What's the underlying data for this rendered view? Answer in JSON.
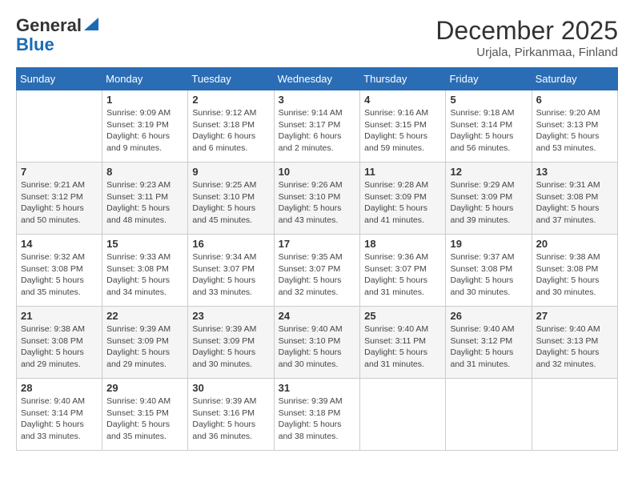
{
  "logo": {
    "general": "General",
    "blue": "Blue"
  },
  "title": {
    "month_year": "December 2025",
    "location": "Urjala, Pirkanmaa, Finland"
  },
  "weekdays": [
    "Sunday",
    "Monday",
    "Tuesday",
    "Wednesday",
    "Thursday",
    "Friday",
    "Saturday"
  ],
  "weeks": [
    [
      {
        "day": "",
        "info": ""
      },
      {
        "day": "1",
        "info": "Sunrise: 9:09 AM\nSunset: 3:19 PM\nDaylight: 6 hours\nand 9 minutes."
      },
      {
        "day": "2",
        "info": "Sunrise: 9:12 AM\nSunset: 3:18 PM\nDaylight: 6 hours\nand 6 minutes."
      },
      {
        "day": "3",
        "info": "Sunrise: 9:14 AM\nSunset: 3:17 PM\nDaylight: 6 hours\nand 2 minutes."
      },
      {
        "day": "4",
        "info": "Sunrise: 9:16 AM\nSunset: 3:15 PM\nDaylight: 5 hours\nand 59 minutes."
      },
      {
        "day": "5",
        "info": "Sunrise: 9:18 AM\nSunset: 3:14 PM\nDaylight: 5 hours\nand 56 minutes."
      },
      {
        "day": "6",
        "info": "Sunrise: 9:20 AM\nSunset: 3:13 PM\nDaylight: 5 hours\nand 53 minutes."
      }
    ],
    [
      {
        "day": "7",
        "info": "Sunrise: 9:21 AM\nSunset: 3:12 PM\nDaylight: 5 hours\nand 50 minutes."
      },
      {
        "day": "8",
        "info": "Sunrise: 9:23 AM\nSunset: 3:11 PM\nDaylight: 5 hours\nand 48 minutes."
      },
      {
        "day": "9",
        "info": "Sunrise: 9:25 AM\nSunset: 3:10 PM\nDaylight: 5 hours\nand 45 minutes."
      },
      {
        "day": "10",
        "info": "Sunrise: 9:26 AM\nSunset: 3:10 PM\nDaylight: 5 hours\nand 43 minutes."
      },
      {
        "day": "11",
        "info": "Sunrise: 9:28 AM\nSunset: 3:09 PM\nDaylight: 5 hours\nand 41 minutes."
      },
      {
        "day": "12",
        "info": "Sunrise: 9:29 AM\nSunset: 3:09 PM\nDaylight: 5 hours\nand 39 minutes."
      },
      {
        "day": "13",
        "info": "Sunrise: 9:31 AM\nSunset: 3:08 PM\nDaylight: 5 hours\nand 37 minutes."
      }
    ],
    [
      {
        "day": "14",
        "info": "Sunrise: 9:32 AM\nSunset: 3:08 PM\nDaylight: 5 hours\nand 35 minutes."
      },
      {
        "day": "15",
        "info": "Sunrise: 9:33 AM\nSunset: 3:08 PM\nDaylight: 5 hours\nand 34 minutes."
      },
      {
        "day": "16",
        "info": "Sunrise: 9:34 AM\nSunset: 3:07 PM\nDaylight: 5 hours\nand 33 minutes."
      },
      {
        "day": "17",
        "info": "Sunrise: 9:35 AM\nSunset: 3:07 PM\nDaylight: 5 hours\nand 32 minutes."
      },
      {
        "day": "18",
        "info": "Sunrise: 9:36 AM\nSunset: 3:07 PM\nDaylight: 5 hours\nand 31 minutes."
      },
      {
        "day": "19",
        "info": "Sunrise: 9:37 AM\nSunset: 3:08 PM\nDaylight: 5 hours\nand 30 minutes."
      },
      {
        "day": "20",
        "info": "Sunrise: 9:38 AM\nSunset: 3:08 PM\nDaylight: 5 hours\nand 30 minutes."
      }
    ],
    [
      {
        "day": "21",
        "info": "Sunrise: 9:38 AM\nSunset: 3:08 PM\nDaylight: 5 hours\nand 29 minutes."
      },
      {
        "day": "22",
        "info": "Sunrise: 9:39 AM\nSunset: 3:09 PM\nDaylight: 5 hours\nand 29 minutes."
      },
      {
        "day": "23",
        "info": "Sunrise: 9:39 AM\nSunset: 3:09 PM\nDaylight: 5 hours\nand 30 minutes."
      },
      {
        "day": "24",
        "info": "Sunrise: 9:40 AM\nSunset: 3:10 PM\nDaylight: 5 hours\nand 30 minutes."
      },
      {
        "day": "25",
        "info": "Sunrise: 9:40 AM\nSunset: 3:11 PM\nDaylight: 5 hours\nand 31 minutes."
      },
      {
        "day": "26",
        "info": "Sunrise: 9:40 AM\nSunset: 3:12 PM\nDaylight: 5 hours\nand 31 minutes."
      },
      {
        "day": "27",
        "info": "Sunrise: 9:40 AM\nSunset: 3:13 PM\nDaylight: 5 hours\nand 32 minutes."
      }
    ],
    [
      {
        "day": "28",
        "info": "Sunrise: 9:40 AM\nSunset: 3:14 PM\nDaylight: 5 hours\nand 33 minutes."
      },
      {
        "day": "29",
        "info": "Sunrise: 9:40 AM\nSunset: 3:15 PM\nDaylight: 5 hours\nand 35 minutes."
      },
      {
        "day": "30",
        "info": "Sunrise: 9:39 AM\nSunset: 3:16 PM\nDaylight: 5 hours\nand 36 minutes."
      },
      {
        "day": "31",
        "info": "Sunrise: 9:39 AM\nSunset: 3:18 PM\nDaylight: 5 hours\nand 38 minutes."
      },
      {
        "day": "",
        "info": ""
      },
      {
        "day": "",
        "info": ""
      },
      {
        "day": "",
        "info": ""
      }
    ]
  ]
}
